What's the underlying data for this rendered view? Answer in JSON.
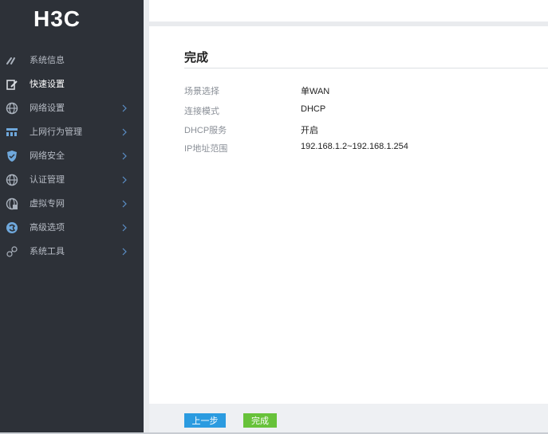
{
  "brand": "H3C",
  "sidebar": {
    "items": [
      {
        "label": "系统信息",
        "icon": "speedometer-icon",
        "active": false,
        "chevron": false
      },
      {
        "label": "快速设置",
        "icon": "edit-icon",
        "active": true,
        "chevron": false
      },
      {
        "label": "网络设置",
        "icon": "globe-icon",
        "active": false,
        "chevron": true
      },
      {
        "label": "上网行为管理",
        "icon": "behavior-icon",
        "active": false,
        "chevron": true
      },
      {
        "label": "网络安全",
        "icon": "shield-icon",
        "active": false,
        "chevron": true
      },
      {
        "label": "认证管理",
        "icon": "globe-icon",
        "active": false,
        "chevron": true
      },
      {
        "label": "虚拟专网",
        "icon": "vpn-globe-icon",
        "active": false,
        "chevron": true
      },
      {
        "label": "高级选项",
        "icon": "advanced-icon",
        "active": false,
        "chevron": true
      },
      {
        "label": "系统工具",
        "icon": "tools-icon",
        "active": false,
        "chevron": true
      }
    ]
  },
  "main": {
    "title": "完成",
    "summary": [
      {
        "key": "场景选择",
        "value": "单WAN"
      },
      {
        "key": "连接模式",
        "value": "DHCP"
      },
      {
        "key": "DHCP服务",
        "value": "开启"
      },
      {
        "key": "IP地址范围",
        "value": "192.168.1.2~192.168.1.254"
      }
    ]
  },
  "footer": {
    "prev_label": "上一步",
    "done_label": "完成"
  },
  "colors": {
    "sidebar_bg": "#2d3138",
    "primary": "#2b9be0",
    "success": "#67c23a"
  }
}
